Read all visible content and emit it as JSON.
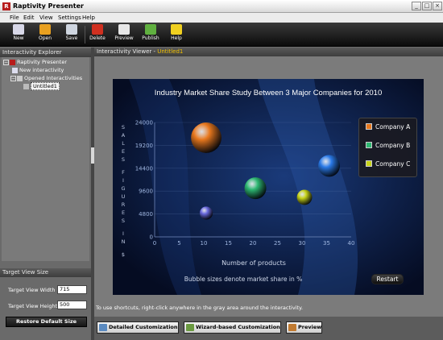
{
  "window": {
    "title": "Raptivity Presenter",
    "app_icon": "R"
  },
  "menu": [
    "File",
    "Edit",
    "View",
    "Settings",
    "Help"
  ],
  "toolbar": [
    {
      "label": "New",
      "icon": "new-document-icon",
      "color": "#d8d8e8"
    },
    {
      "label": "Open",
      "icon": "folder-icon",
      "color": "#e8a020"
    },
    {
      "label": "Save",
      "icon": "save-icon",
      "color": "#cfd6e0"
    },
    {
      "label": "Delete",
      "icon": "delete-icon",
      "color": "#d03020"
    },
    {
      "label": "Preview",
      "icon": "preview-icon",
      "color": "#e8e8e8"
    },
    {
      "label": "Publish",
      "icon": "publish-icon",
      "color": "#60b040"
    },
    {
      "label": "Help",
      "icon": "help-icon",
      "color": "#f0d020"
    }
  ],
  "explorer": {
    "title": "Interactivity Explorer",
    "tree": {
      "root": "Raptivity Presenter",
      "items": [
        "New interactivity",
        "Opened Interactivities"
      ],
      "child": "Untitled1"
    }
  },
  "target_view": {
    "title": "Target View Size",
    "width_label": "Target View Width",
    "width_value": "715",
    "height_label": "Target View Height",
    "height_value": "500",
    "restore_label": "Restore Default Size"
  },
  "viewer": {
    "title": "Interactivity Viewer - ",
    "doc_name": "Untitled1",
    "hint": "To use shortcuts, right-click anywhere in the gray area around the interactivity."
  },
  "bottom_buttons": [
    {
      "label": "Detailed Customization",
      "icon": "customize-icon"
    },
    {
      "label": "Wizard-based Customization",
      "icon": "wizard-icon"
    },
    {
      "label": "Preview",
      "icon": "preview-icon"
    }
  ],
  "chart_data": {
    "type": "scatter",
    "title": "Industry Market Share Study Between 3 Major Companies for 2010",
    "xlabel": "Number of products",
    "ylabel": "SALES FIGURES IN $",
    "note": "Bubble sizes denote market share in %",
    "xlim": [
      0,
      40
    ],
    "ylim": [
      0,
      24000
    ],
    "xticks": [
      "0",
      "5",
      "10",
      "15",
      "20",
      "25",
      "30",
      "35",
      "40"
    ],
    "yticks": [
      "0",
      "4800",
      "9600",
      "14400",
      "19200",
      "24000"
    ],
    "legend_position": "top-right",
    "series": [
      {
        "name": "Company A",
        "color": "#e8781e",
        "points": [
          {
            "x": 10.5,
            "y": 20800,
            "r": 14
          }
        ]
      },
      {
        "name": "Company B",
        "color": "#2eb872",
        "points": [
          {
            "x": 20.5,
            "y": 10200,
            "r": 10
          }
        ]
      },
      {
        "name": "Company C",
        "color": "#c8d418",
        "points": [
          {
            "x": 30.5,
            "y": 8300,
            "r": 7
          }
        ]
      },
      {
        "name": "",
        "color": "#2a7ae8",
        "points": [
          {
            "x": 35.5,
            "y": 14900,
            "r": 10
          }
        ]
      },
      {
        "name": "",
        "color": "#6b6be0",
        "points": [
          {
            "x": 10.5,
            "y": 5000,
            "r": 6
          }
        ]
      }
    ],
    "restart_label": "Restart"
  }
}
